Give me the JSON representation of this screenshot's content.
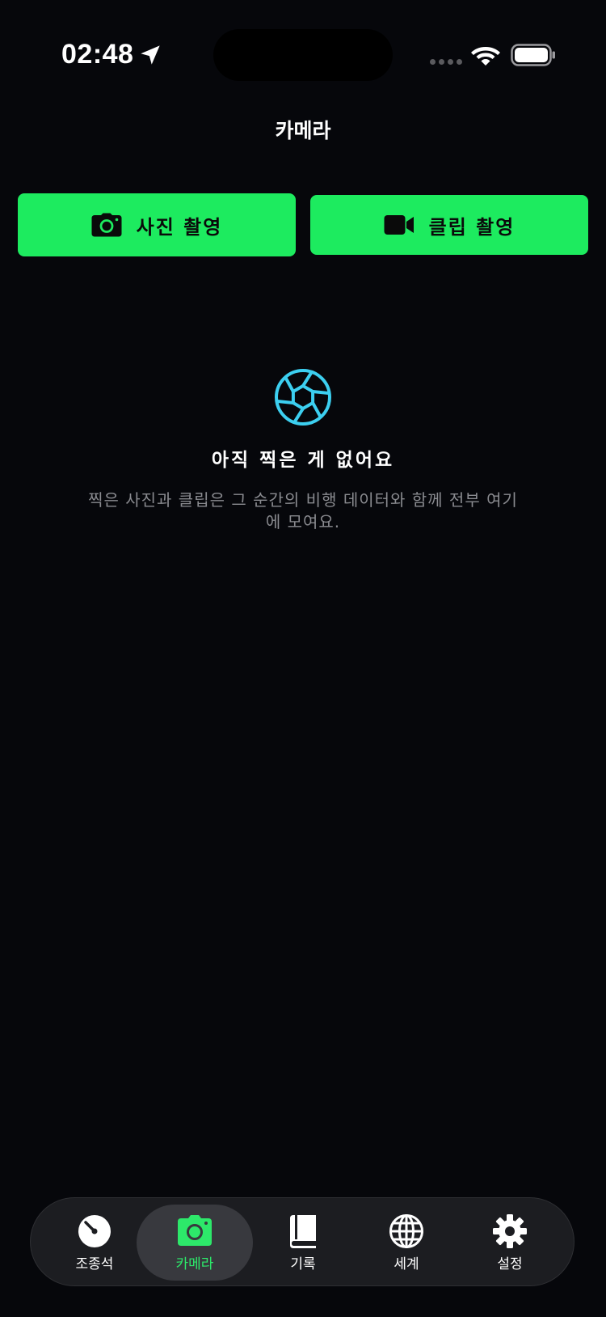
{
  "status_bar": {
    "time": "02:48"
  },
  "nav": {
    "title": "카메라"
  },
  "actions": {
    "photo_label": "사진 촬영",
    "clip_label": "클립 촬영"
  },
  "empty_state": {
    "title": "아직 찍은 게 없어요",
    "description": "찍은 사진과 클립은 그 순간의 비행 데이터와 함께 전부 여기에 모여요.",
    "icon": "aperture-icon"
  },
  "tabs": [
    {
      "label": "조종석",
      "icon": "gauge-icon",
      "active": false
    },
    {
      "label": "카메라",
      "icon": "camera-icon",
      "active": true
    },
    {
      "label": "기록",
      "icon": "book-icon",
      "active": false
    },
    {
      "label": "세계",
      "icon": "globe-icon",
      "active": false
    },
    {
      "label": "설정",
      "icon": "gear-icon",
      "active": false
    }
  ],
  "colors": {
    "accent": "#1deb5f",
    "tab_active": "#2de86a",
    "aperture": "#3ccff0",
    "background": "#06070b"
  }
}
